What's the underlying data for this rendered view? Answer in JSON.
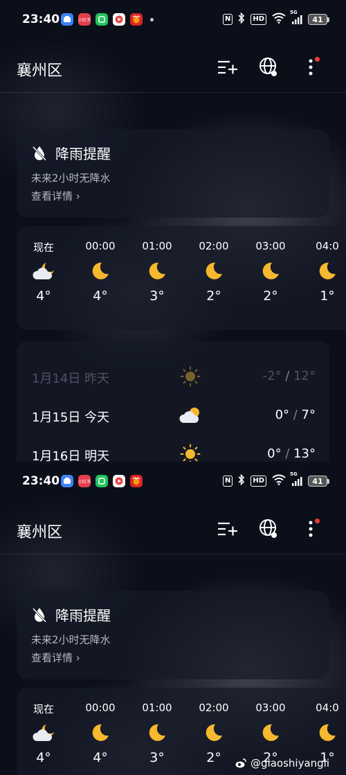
{
  "status": {
    "time": "23:40",
    "apps": [
      {
        "name": "blue-app-icon",
        "color": "#3b82f6",
        "label": ""
      },
      {
        "name": "xiaohongshu-icon",
        "color": "#e53e4c",
        "label": "小红书"
      },
      {
        "name": "green-app-icon",
        "color": "#22c55e",
        "label": ""
      },
      {
        "name": "red-video-icon",
        "color": "#ef4444",
        "label": ""
      },
      {
        "name": "game-app-icon",
        "color": "#dc2626",
        "label": ""
      }
    ],
    "hd_label": "HD",
    "signal_label": "5G",
    "battery": "41"
  },
  "header": {
    "title": "襄州区"
  },
  "alert": {
    "title": "降雨提醒",
    "subtitle": "未来2小时无降水",
    "link": "查看详情 ›"
  },
  "hourly": [
    {
      "time": "现在",
      "icon": "cloud-moon",
      "temp": "4°"
    },
    {
      "time": "00:00",
      "icon": "moon",
      "temp": "4°"
    },
    {
      "time": "01:00",
      "icon": "moon",
      "temp": "3°"
    },
    {
      "time": "02:00",
      "icon": "moon",
      "temp": "2°"
    },
    {
      "time": "03:00",
      "icon": "moon",
      "temp": "2°"
    },
    {
      "time": "04:0",
      "icon": "moon",
      "temp": "1°"
    }
  ],
  "daily": [
    {
      "date": "1月14日 昨天",
      "icon": "sun",
      "low": "-2°",
      "high": "12°",
      "faded": true
    },
    {
      "date": "1月15日 今天",
      "icon": "cloud-sun",
      "low": "0°",
      "high": "7°",
      "faded": false
    },
    {
      "date": "1月16日 明天",
      "icon": "sun",
      "low": "0°",
      "high": "13°",
      "faded": false
    }
  ],
  "watermark": "@giaoshiyangli",
  "colors": {
    "accent_yellow": "#f5b82e",
    "red_dot": "#ef3b3b"
  }
}
